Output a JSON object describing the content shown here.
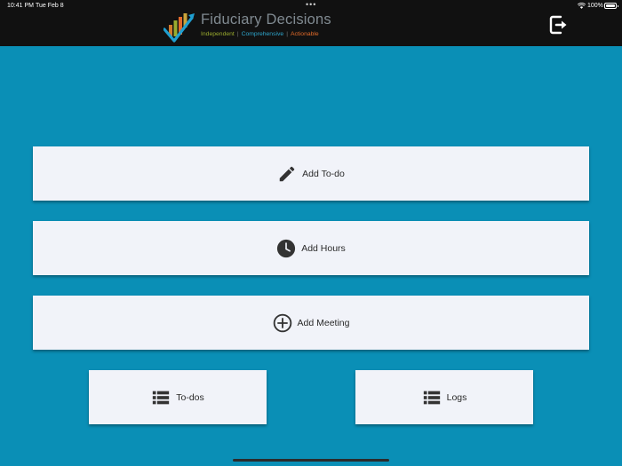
{
  "status_bar": {
    "time": "10:41 PM",
    "date": "Tue Feb 8",
    "dots": "•••",
    "battery": "100%"
  },
  "header": {
    "brand_name": "Fiduciary Decisions",
    "tagline": [
      "Independent",
      "Comprehensive",
      "Actionable"
    ],
    "logout_icon": "logout-icon"
  },
  "actions": {
    "add_todo": {
      "label": "Add To-do",
      "icon": "pencil-icon"
    },
    "add_hours": {
      "label": "Add Hours",
      "icon": "clock-icon"
    },
    "add_meeting": {
      "label": "Add Meeting",
      "icon": "plus-circle-icon"
    },
    "todos": {
      "label": "To-dos",
      "icon": "list-icon"
    },
    "logs": {
      "label": "Logs",
      "icon": "list-icon"
    }
  },
  "colors": {
    "background": "#0a8fb6",
    "topbar": "#111111",
    "button": "#f1f3f9",
    "tagline_independent": "#9aab2e",
    "tagline_comprehensive": "#2ea6cc",
    "tagline_actionable": "#e26b2a"
  }
}
